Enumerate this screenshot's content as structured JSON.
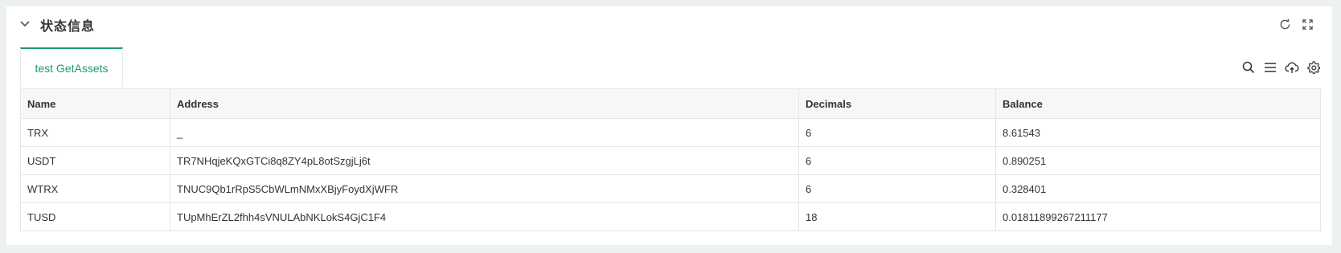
{
  "panel": {
    "title": "状态信息"
  },
  "tabs": [
    {
      "label": "test GetAssets"
    }
  ],
  "table": {
    "columns": [
      "Name",
      "Address",
      "Decimals",
      "Balance"
    ],
    "rows": [
      {
        "name": "TRX",
        "address": "_",
        "decimals": "6",
        "balance": "8.61543"
      },
      {
        "name": "USDT",
        "address": "TR7NHqjeKQxGTCi8q8ZY4pL8otSzgjLj6t",
        "decimals": "6",
        "balance": "0.890251"
      },
      {
        "name": "WTRX",
        "address": "TNUC9Qb1rRpS5CbWLmNMxXBjyFoydXjWFR",
        "decimals": "6",
        "balance": "0.328401"
      },
      {
        "name": "TUSD",
        "address": "TUpMhErZL2fhh4sVNULAbNKLokS4GjC1F4",
        "decimals": "18",
        "balance": "0.01811899267211177"
      }
    ]
  },
  "icons": {
    "header": [
      "refresh-icon",
      "fullscreen-icon"
    ],
    "toolbar": [
      "search-icon",
      "list-icon",
      "cloud-upload-icon",
      "gear-icon"
    ]
  },
  "colors": {
    "accent": "#1a9a75",
    "background": "#eef1f2",
    "header_bg": "#f7f7f7",
    "border": "#e6e6e6"
  }
}
